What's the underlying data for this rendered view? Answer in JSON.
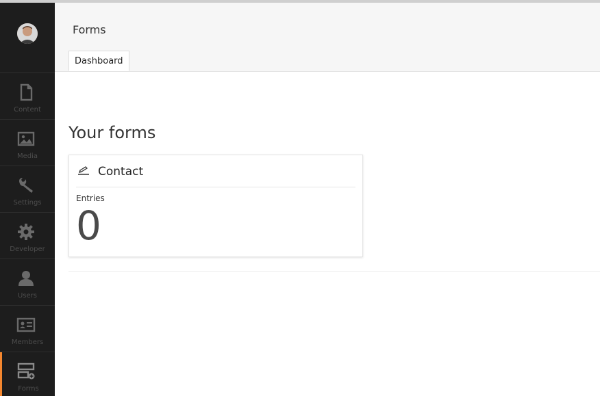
{
  "sidebar": {
    "avatar_icon": "user-avatar",
    "items": [
      {
        "label": "Content",
        "icon": "document-icon"
      },
      {
        "label": "Media",
        "icon": "image-icon"
      },
      {
        "label": "Settings",
        "icon": "wrench-icon"
      },
      {
        "label": "Developer",
        "icon": "gear-icon"
      },
      {
        "label": "Users",
        "icon": "user-icon"
      },
      {
        "label": "Members",
        "icon": "id-card-icon"
      },
      {
        "label": "Forms",
        "icon": "forms-icon"
      }
    ],
    "active_item": "Forms",
    "accent_color": "#f5872f"
  },
  "header": {
    "title": "Forms",
    "tabs": [
      {
        "label": "Dashboard"
      }
    ]
  },
  "main": {
    "heading": "Your forms",
    "forms": [
      {
        "title": "Contact",
        "icon": "form-edit-icon",
        "entries_label": "Entries",
        "entries_count": "0"
      }
    ]
  }
}
